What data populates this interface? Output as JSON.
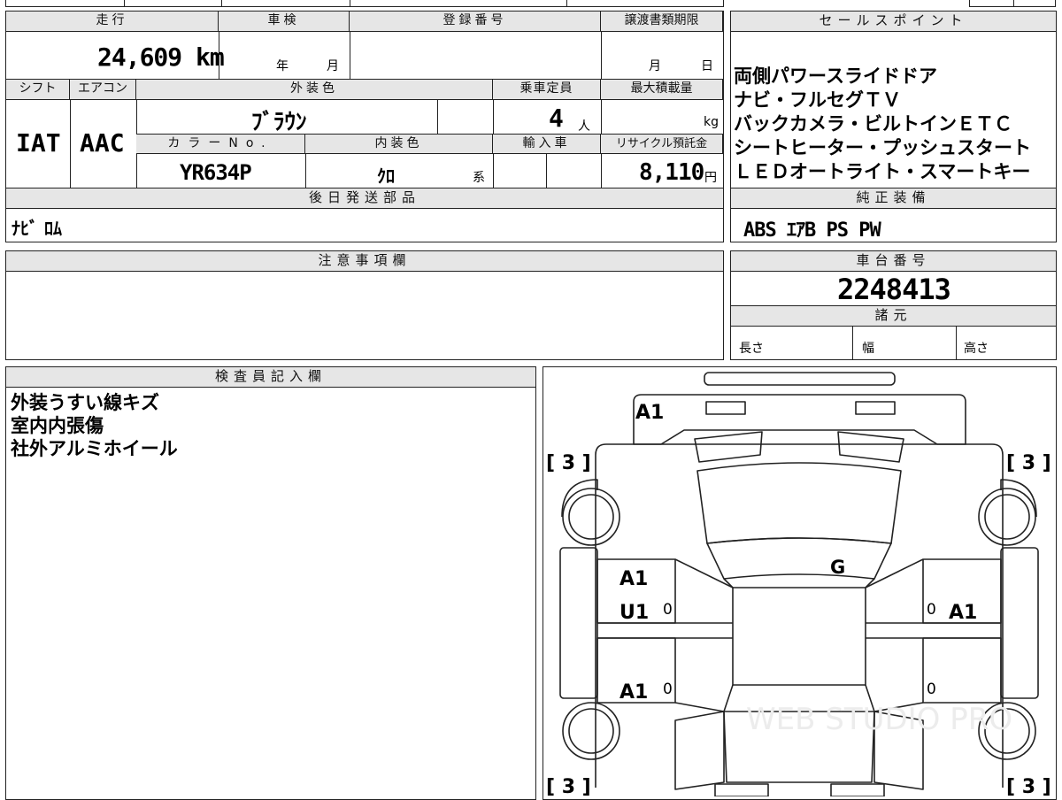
{
  "main_sheet": {
    "headers": {
      "mileage": "走行",
      "inspection": "車検",
      "registration_no": "登録番号",
      "transfer_deadline": "譲渡書類期限",
      "shift": "シフト",
      "aircon": "エアコン",
      "exterior_color": "外装色",
      "capacity": "乗車定員",
      "max_load": "最大積載量",
      "color_no": "カラーNo.",
      "interior_color": "内装色",
      "import": "輸入車",
      "recycle_fee": "リサイクル預託金",
      "parts_later": "後日発送部品"
    },
    "values": {
      "mileage": "24,609",
      "mileage_unit": "km",
      "inspection_year_unit": "年",
      "inspection_month_unit": "月",
      "deadline_month_unit": "月",
      "deadline_day_unit": "日",
      "shift": "IAT",
      "aircon": "AAC",
      "exterior_color": "ﾌﾞﾗｳﾝ",
      "capacity": "4",
      "capacity_unit": "人",
      "max_load_unit": "kg",
      "color_no": "YR634P",
      "interior_color": "ｸﾛ",
      "interior_color_suffix": "系",
      "recycle_fee": "8,110",
      "recycle_fee_unit": "円",
      "parts_later": "ﾅﾋﾞ ﾛﾑ"
    }
  },
  "sales_points": {
    "header": "セールスポイント",
    "lines": [
      "両側パワースライドドア",
      "ナビ・フルセグＴＶ",
      "バックカメラ・ビルトインＥＴＣ",
      "シートヒーター・プッシュスタート",
      "ＬＥＤオートライト・スマートキー"
    ]
  },
  "standard_equipment": {
    "header": "純正装備",
    "value": "ABS ｴｱB PS PW"
  },
  "notes": {
    "header": "注意事項欄",
    "value": ""
  },
  "chassis": {
    "header": "車台番号",
    "value": "2248413"
  },
  "specs": {
    "header": "諸元",
    "length_label": "長さ",
    "width_label": "幅",
    "height_label": "高さ"
  },
  "inspector": {
    "header": "検査員記入欄",
    "lines": [
      "外装うすい線キズ",
      "室内内張傷",
      "社外アルミホイール"
    ]
  },
  "diagram": {
    "marks": {
      "front": "A1",
      "center": "G",
      "left_front_door": "A1",
      "left_front_door2": "U1",
      "left_rear_door": "A1",
      "right_front_door": "A1",
      "door_zero": "0"
    },
    "tire_label": "[ 3 ]",
    "watermark": "WEB STUDIO PRO"
  }
}
